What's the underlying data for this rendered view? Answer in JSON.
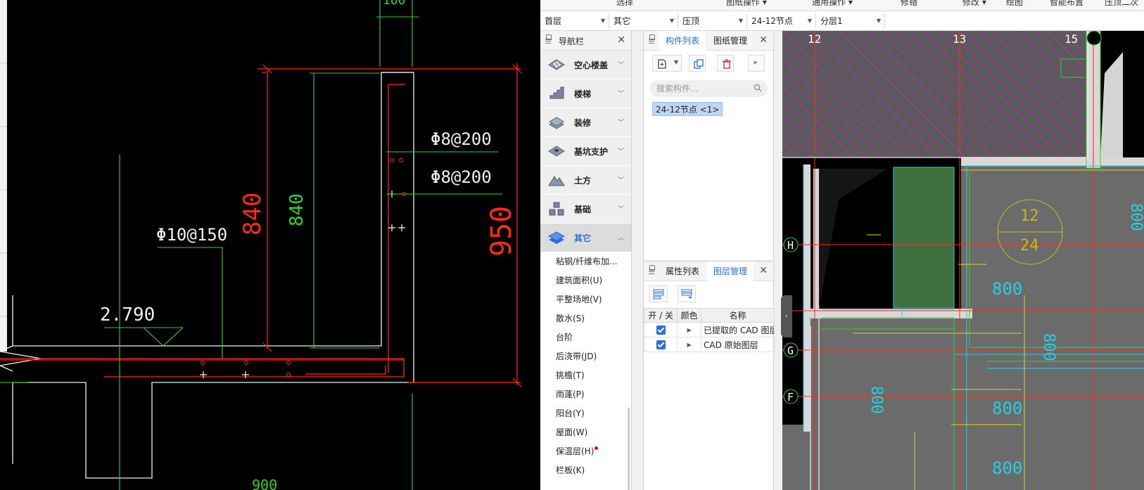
{
  "ribbon": {
    "fragments": [
      "选择",
      "图纸操作 ▾",
      "通用操作 ▾",
      "修错",
      "修改 ▾",
      "绘图",
      "智能布置",
      "压顶二次"
    ]
  },
  "selectors": [
    {
      "value": "首层"
    },
    {
      "value": "其它"
    },
    {
      "value": "压顶"
    },
    {
      "value": "24-12节点"
    },
    {
      "value": "分层1"
    }
  ],
  "nav": {
    "title": "导航栏",
    "categories": [
      {
        "label": "空心楼盖",
        "icon": "hollow-floor-icon"
      },
      {
        "label": "楼梯",
        "icon": "stairs-icon"
      },
      {
        "label": "装修",
        "icon": "decoration-icon"
      },
      {
        "label": "基坑支护",
        "icon": "pit-support-icon"
      },
      {
        "label": "土方",
        "icon": "earthwork-icon"
      },
      {
        "label": "基础",
        "icon": "foundation-icon"
      },
      {
        "label": "其它",
        "icon": "other-layers-icon",
        "active": true
      }
    ],
    "sub_items": [
      "粘钢/纤维布加...",
      "建筑面积(U)",
      "平整场地(V)",
      "散水(S)",
      "台阶",
      "后浇带(JD)",
      "挑檐(T)",
      "雨蓬(P)",
      "阳台(Y)",
      "屋面(W)",
      "保温层(H)",
      "栏板(K)"
    ]
  },
  "component_panel": {
    "tabs": [
      "构件列表",
      "图纸管理"
    ],
    "search_placeholder": "搜索构件...",
    "item": "24-12节点 <1>"
  },
  "layer_panel": {
    "tabs": [
      "属性列表",
      "图层管理"
    ],
    "columns": [
      "开 / 关",
      "颜色",
      "名称"
    ],
    "rows": [
      {
        "on": true,
        "name": "已提取的 CAD 图层"
      },
      {
        "on": true,
        "name": "CAD 原始图层"
      }
    ]
  },
  "cad_left": {
    "dims": [
      "100",
      "840",
      "840",
      "950",
      "900"
    ],
    "rebar": [
      "Φ8@200",
      "Φ8@200",
      "Φ10@150"
    ],
    "elevation": "2.790"
  },
  "cad_right": {
    "axes": [
      "12",
      "13",
      "15",
      "H",
      "G",
      "F"
    ],
    "labels": [
      "12",
      "24",
      "800",
      "800",
      "800",
      "800",
      "800",
      "800"
    ]
  },
  "colors": {
    "accent": "#2a6fd6",
    "cad_red": "#ff2a1a",
    "cad_green": "#2fd02f",
    "cad_cyan": "#23d0e6",
    "cad_magenta": "#c81ec8"
  }
}
